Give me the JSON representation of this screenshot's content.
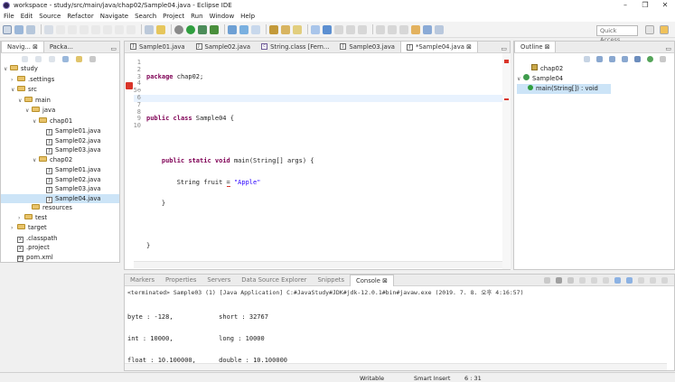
{
  "window": {
    "title": "workspace - study/src/main/java/chap02/Sample04.java - Eclipse IDE",
    "minimize": "–",
    "maximize": "❐",
    "close": "✕"
  },
  "menu": [
    "File",
    "Edit",
    "Source",
    "Refactor",
    "Navigate",
    "Search",
    "Project",
    "Run",
    "Window",
    "Help"
  ],
  "toolbar": {
    "quick_access": "Quick Access"
  },
  "navigator": {
    "tabs": [
      {
        "label": "Navig... ⊠"
      },
      {
        "label": "Packa..."
      }
    ],
    "tree": [
      {
        "label": "study",
        "depth": 0,
        "kind": "project",
        "open": true
      },
      {
        "label": ".settings",
        "depth": 1,
        "kind": "folder",
        "open": false
      },
      {
        "label": "src",
        "depth": 1,
        "kind": "folder",
        "open": true
      },
      {
        "label": "main",
        "depth": 2,
        "kind": "folder",
        "open": true
      },
      {
        "label": "java",
        "depth": 3,
        "kind": "folder",
        "open": true
      },
      {
        "label": "chap01",
        "depth": 4,
        "kind": "folder",
        "open": true
      },
      {
        "label": "Sample01.java",
        "depth": 5,
        "kind": "file"
      },
      {
        "label": "Sample02.java",
        "depth": 5,
        "kind": "file"
      },
      {
        "label": "Sample03.java",
        "depth": 5,
        "kind": "file"
      },
      {
        "label": "chap02",
        "depth": 4,
        "kind": "folder",
        "open": true
      },
      {
        "label": "Sample01.java",
        "depth": 5,
        "kind": "file"
      },
      {
        "label": "Sample02.java",
        "depth": 5,
        "kind": "file"
      },
      {
        "label": "Sample03.java",
        "depth": 5,
        "kind": "file"
      },
      {
        "label": "Sample04.java",
        "depth": 5,
        "kind": "file",
        "selected": true
      },
      {
        "label": "resources",
        "depth": 3,
        "kind": "folder"
      },
      {
        "label": "test",
        "depth": 2,
        "kind": "folder",
        "open": false
      },
      {
        "label": "target",
        "depth": 1,
        "kind": "folder",
        "open": false
      },
      {
        "label": ".classpath",
        "depth": 1,
        "kind": "xfile"
      },
      {
        "label": ".project",
        "depth": 1,
        "kind": "xfile"
      },
      {
        "label": "pom.xml",
        "depth": 1,
        "kind": "mfile"
      }
    ]
  },
  "editor": {
    "tabs": [
      {
        "label": "Sample01.java",
        "active": false
      },
      {
        "label": "Sample02.java",
        "active": false
      },
      {
        "label": "String.class [Fern...",
        "active": false
      },
      {
        "label": "Sample03.java",
        "active": false
      },
      {
        "label": "*Sample04.java ⊠",
        "active": true
      }
    ],
    "line_numbers": [
      "1",
      "2",
      "3",
      "4",
      "5⊖",
      "6",
      "7",
      "8",
      "9",
      "10"
    ],
    "lines": {
      "l1_kw": "package",
      "l1_rest": " chap02;",
      "l3_kw1": "public",
      "l3_kw2": "class",
      "l3_rest": " Sample04 {",
      "l5_kw1": "public",
      "l5_kw2": "static",
      "l5_kw3": "void",
      "l5_rest": " main(String[] args) {",
      "l6_pre": "String fruit ",
      "l6_eq": "=",
      "l6_str": "\"Apple\"",
      "l7": "}",
      "l9": "}"
    }
  },
  "outline": {
    "tab": "Outline ⊠",
    "items": [
      {
        "label": "chap02",
        "depth": 0
      },
      {
        "label": "Sample04",
        "depth": 0
      },
      {
        "label": "main(String[]) : void",
        "depth": 1
      }
    ]
  },
  "bottom": {
    "tabs": [
      {
        "label": "Markers"
      },
      {
        "label": "Properties"
      },
      {
        "label": "Servers"
      },
      {
        "label": "Data Source Explorer"
      },
      {
        "label": "Snippets"
      },
      {
        "label": "Console ⊠"
      }
    ],
    "terminated": "<terminated> Sample03 (1) [Java Application] C:#JavaStudy#JDK#jdk-12.0.1#bin#javaw.exe (2019. 7. 8. 오후 4:16:57)",
    "output": [
      "byte : -128,            short : 32767",
      "int : 10000,            long : 10000",
      "float : 10.100000,      double : 10.100000"
    ]
  },
  "status": {
    "writable": "Writable",
    "insert": "Smart Insert",
    "position": "6 : 31"
  },
  "colors": {
    "accent": "#2a5db0",
    "keyword": "#7f0055",
    "string": "#2a00ff",
    "selection": "#cce4f7",
    "current_line": "#e8f2fe"
  }
}
